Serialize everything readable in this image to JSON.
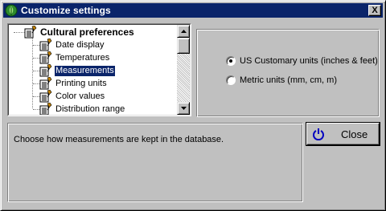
{
  "window": {
    "title": "Customize settings",
    "app_icon": "leaf-icon",
    "close_glyph": "X"
  },
  "tree": {
    "root_label": "Cultural preferences",
    "items": [
      {
        "label": "Date display",
        "selected": false
      },
      {
        "label": "Temperatures",
        "selected": false
      },
      {
        "label": "Measurements",
        "selected": true
      },
      {
        "label": "Printing units",
        "selected": false
      },
      {
        "label": "Color values",
        "selected": false
      },
      {
        "label": "Distribution range",
        "selected": false
      }
    ],
    "node_icon": "settings-page-icon"
  },
  "options": {
    "radios": [
      {
        "label": "US Customary units (inches & feet)",
        "checked": true
      },
      {
        "label": "Metric units (mm, cm, m)",
        "checked": false
      }
    ]
  },
  "description": {
    "text": "Choose how measurements are kept in the database."
  },
  "close_button": {
    "label": "Close",
    "icon": "power-icon"
  },
  "colors": {
    "titlebar": "#0a246a",
    "face": "#c0c0c0",
    "selection": "#0a246a",
    "power_icon": "#0000c0",
    "leaf_icon": "#2e8b2e"
  }
}
